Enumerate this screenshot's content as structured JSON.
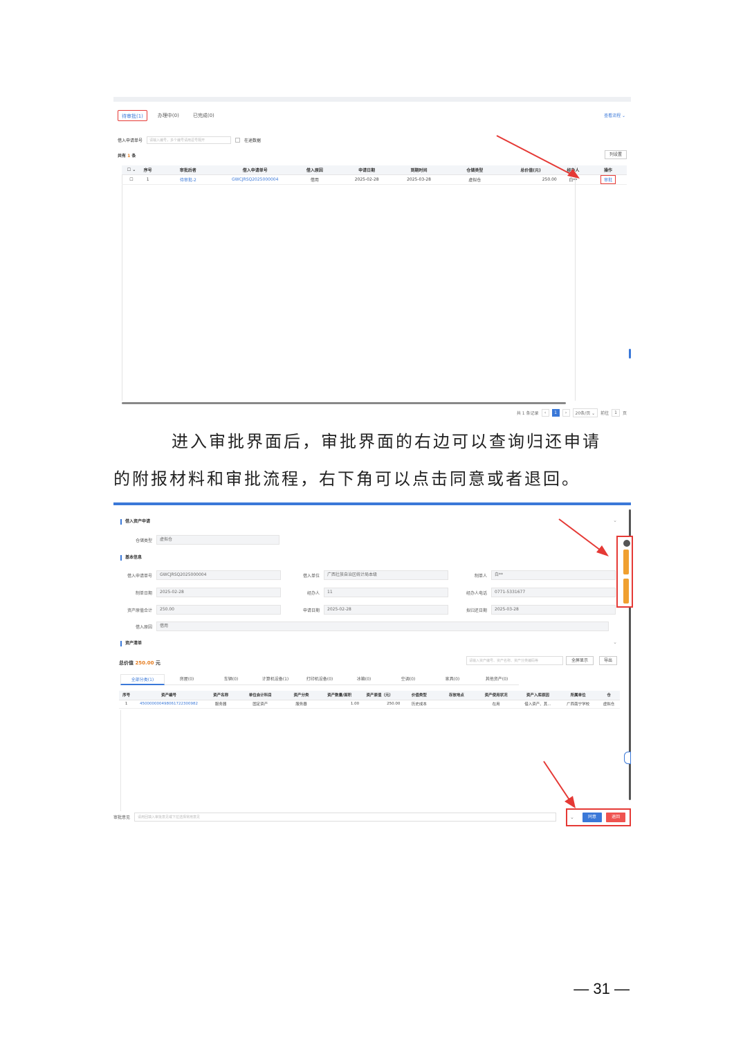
{
  "shot1": {
    "tabs": [
      "待审批(1)",
      "办理中(0)",
      "已完成(0)"
    ],
    "help": "查看流程 ⌄",
    "filter_label": "借入申请单号",
    "filter_placeholder": "请输入编号，多个编号请用逗号隔开",
    "filter_checkbox_label": "在途数据",
    "count_prefix": "共有",
    "count_value": "1",
    "count_suffix": "条",
    "column_settings": "列设置",
    "table": {
      "headers": [
        "序号",
        "审批后者",
        "借入申请单号",
        "借入原因",
        "申请日期",
        "到期时间",
        "仓储类型",
        "总价值(元)",
        "经办人",
        "操作"
      ],
      "rows": [
        [
          "1",
          "待审批-2",
          "GWCJRSQ2025000004",
          "借用",
          "2025-02-28",
          "2025-03-28",
          "虚拟仓",
          "250.00",
          "白**",
          "审批"
        ]
      ]
    },
    "pager": {
      "total": "共 1 条记录",
      "page": "1",
      "per_page": "20条/页",
      "goto": "前往",
      "goto_page": "1",
      "unit": "页"
    }
  },
  "paragraph": {
    "line1": "进入审批界面后，审批界面的右边可以查询归还申请",
    "line2": "的附报材料和审批流程，右下角可以点击同意或者退回。"
  },
  "shot2": {
    "sections": {
      "apply": "借入资产申请",
      "basic": "基本信息",
      "assets": "资产清单"
    },
    "storage_type_label": "仓储类型",
    "storage_type_value": "虚拟仓",
    "fields": {
      "apply_no_label": "借入申请单号",
      "apply_no_value": "GWCJRSQ2025000004",
      "borrow_unit_label": "借入单位",
      "borrow_unit_value": "广西壮族自治区统计局本级",
      "creator_label": "制单人",
      "creator_value": "白**",
      "date_label": "制单日期",
      "date_value": "2025-02-28",
      "handler_label": "经办人",
      "handler_value": "11",
      "phone_label": "经办人电话",
      "phone_value": "0771-5331677",
      "total_label": "资产原值合计",
      "total_value": "250.00",
      "apply_date_label": "申请日期",
      "apply_date_value": "2025-02-28",
      "return_date_label": "拟归还日期",
      "return_date_value": "2025-03-28",
      "reason_label": "借入原因",
      "reason_value": "借用"
    },
    "total_prefix": "总价值",
    "total_value": "250.00",
    "total_unit": "元",
    "search_placeholder": "请输入资产编号、资产名称、资产分类编码等",
    "btn_fullscreen": "全屏显示",
    "btn_export": "导出",
    "tabs": [
      "全部分类(1)",
      "房屋(0)",
      "车辆(0)",
      "计算机设备(1)",
      "打印机设备(0)",
      "冰箱(0)",
      "空调(0)",
      "家具(0)",
      "其他资产(0)"
    ],
    "table": {
      "headers": [
        "序号",
        "资产编号",
        "资产名称",
        "单位会计科目",
        "资产分类",
        "资产数量/面积",
        "资产原值（元）",
        "价值类型",
        "存放地点",
        "资产使用状况",
        "资产入库原因",
        "所属单位",
        "仓"
      ],
      "rows": [
        [
          "1",
          "450000000498061722300982",
          "服务器",
          "固定资产",
          "服务器",
          "1.00",
          "250.00",
          "历史成本",
          "",
          "在用",
          "借入资产、其...",
          "广西南宁学校",
          "虚拟仓"
        ]
      ]
    },
    "opinion_label": "审批意见",
    "opinion_placeholder": "请用回填入审批意见或下拉选择常用意见",
    "btn_agree": "同意",
    "btn_back": "退回"
  },
  "page_number": "— 31 —"
}
